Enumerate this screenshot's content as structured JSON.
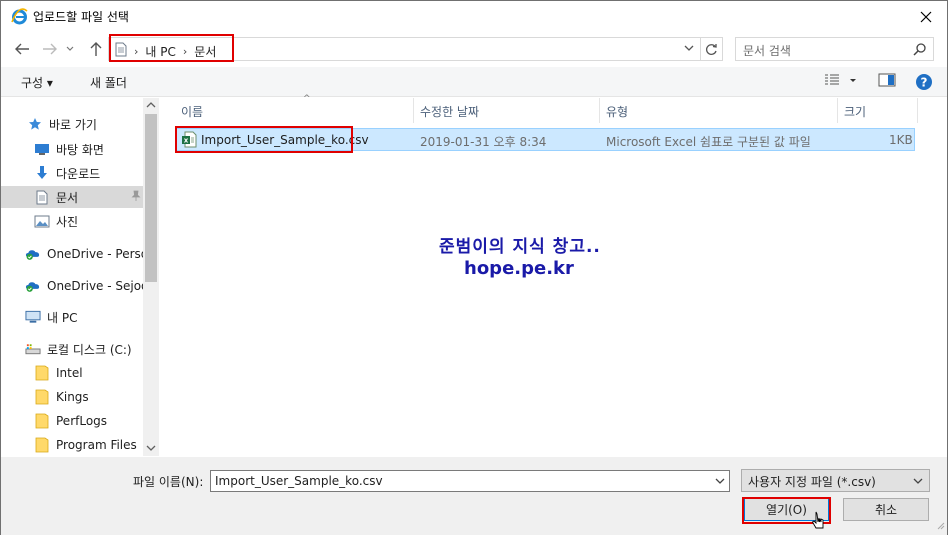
{
  "window": {
    "title": "업로드할 파일 선택"
  },
  "address": {
    "crumbs": [
      "내 PC",
      "문서"
    ]
  },
  "search": {
    "placeholder": "문서 검색"
  },
  "toolbar": {
    "organize": "구성 ▾",
    "new_folder": "새 폴더"
  },
  "nav": {
    "items": [
      {
        "label": "바로 가기",
        "icon": "star-icon"
      },
      {
        "label": "바탕 화면",
        "icon": "desktop-icon",
        "pinned": true
      },
      {
        "label": "다운로드",
        "icon": "download-icon",
        "pinned": true
      },
      {
        "label": "문서",
        "icon": "document-icon",
        "pinned": true,
        "selected": true
      },
      {
        "label": "사진",
        "icon": "picture-icon",
        "pinned": true
      },
      {
        "label": "OneDrive - Persor",
        "icon": "onedrive-icon"
      },
      {
        "label": "OneDrive - Sejoo",
        "icon": "onedrive-icon"
      },
      {
        "label": "내 PC",
        "icon": "computer-icon"
      },
      {
        "label": "로컬 디스크 (C:)",
        "icon": "disk-icon"
      },
      {
        "label": "Intel",
        "icon": "folder-icon"
      },
      {
        "label": "Kings",
        "icon": "folder-icon"
      },
      {
        "label": "PerfLogs",
        "icon": "folder-icon"
      },
      {
        "label": "Program Files",
        "icon": "folder-icon"
      }
    ]
  },
  "filelist": {
    "columns": [
      "이름",
      "수정한 날짜",
      "유형",
      "크기"
    ],
    "rows": [
      {
        "name": "Import_User_Sample_ko.csv",
        "date": "2019-01-31 오후 8:34",
        "type": "Microsoft Excel 쉼표로 구분된 값 파일",
        "size": "1KB"
      }
    ]
  },
  "watermark": {
    "line1": "준범이의 지식 창고..",
    "line2": "hope.pe.kr"
  },
  "bottom": {
    "filename_label": "파일 이름(N):",
    "filename_value": "Import_User_Sample_ko.csv",
    "filetype": "사용자 지정 파일 (*.csv)",
    "open": "열기(O)",
    "cancel": "취소"
  },
  "colors": {
    "selection": "#cce8ff",
    "highlight_red": "#e00000",
    "watermark": "#1a1aa8"
  }
}
